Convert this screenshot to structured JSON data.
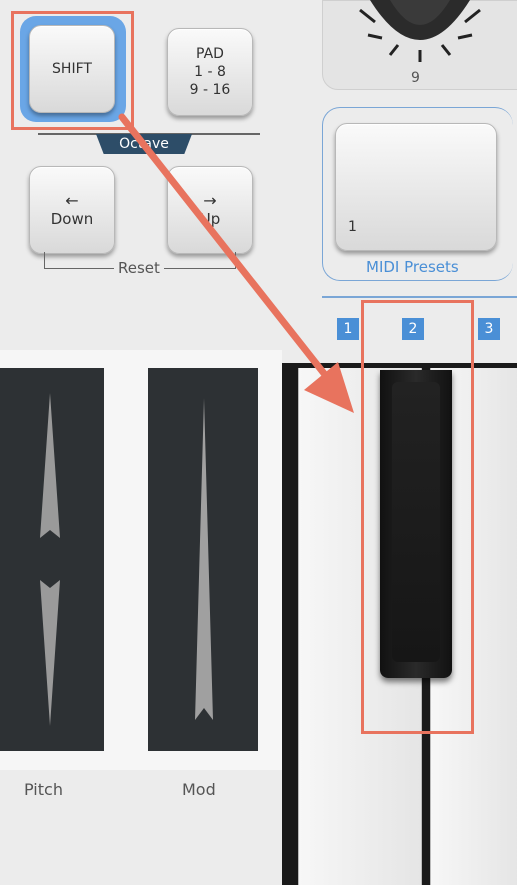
{
  "buttons": {
    "shift": "SHIFT",
    "pad": [
      "PAD",
      "1 - 8",
      "9 - 16"
    ],
    "octave_down": [
      "←",
      "Down"
    ],
    "octave_up": [
      "→",
      "Up"
    ],
    "midi_preset_number": "1"
  },
  "labels": {
    "knob_number": "9",
    "octave": "Octave",
    "reset": "Reset",
    "midi_presets": "MIDI Presets",
    "pitch": "Pitch",
    "mod": "Mod"
  },
  "preset_slots": [
    "1",
    "2",
    "3"
  ],
  "colors": {
    "annotation": "#e8735e",
    "accent_blue": "#4a8fd6",
    "panel": "#ececec"
  },
  "icons": [
    "knob-icon",
    "arrow-left-icon",
    "arrow-right-icon",
    "pitch-wheel-icon",
    "mod-wheel-icon"
  ]
}
